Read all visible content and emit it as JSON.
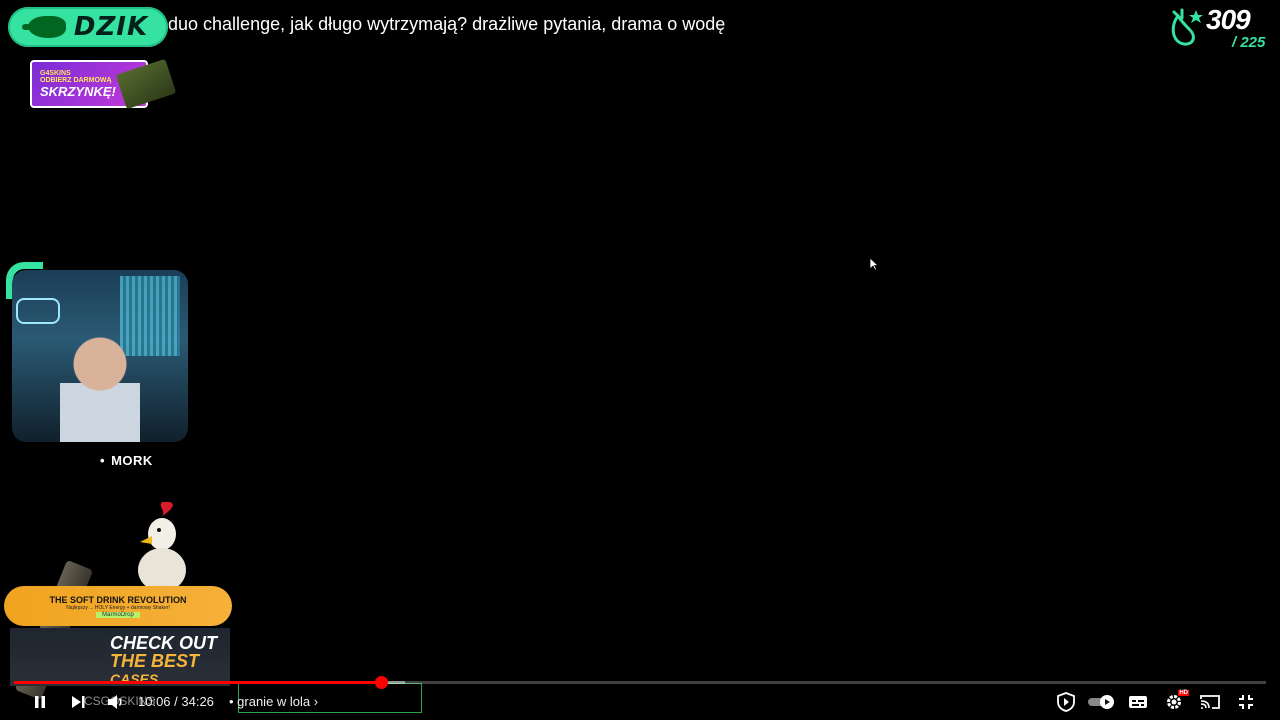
{
  "brand": {
    "name": "DZIK",
    "color": "#35e2a0"
  },
  "video": {
    "title": "duo challenge, jak długo wytrzymają? drażliwe pytania, drama o wodę"
  },
  "promo": {
    "small_text": "ODBIERZ DARMOWĄ",
    "big_text": "SKRZYNKĘ!",
    "logo_text": "G4SKINS"
  },
  "counter": {
    "value": "309",
    "total": "/ 225",
    "icon": "eggplant-icon"
  },
  "webcam": {
    "streamer_name": "MORK"
  },
  "sponsor": {
    "headline": "THE SOFT DRINK REVOLUTION",
    "subline": "Najlepszy ... HOLY Energy + darmowy Shaker!",
    "code": "MarmoDrop",
    "cases_line1": "CHECK OUT",
    "cases_line2": "THE BEST",
    "cases_line3": "CASES",
    "overlay_label": "CSGOSKINS"
  },
  "player": {
    "current_time": "10:06",
    "duration": "34:26",
    "time_text": "10:06 / 34:26",
    "chapter_text": "• granie w lola ›",
    "progress_fraction": 0.293,
    "buffered_fraction": 0.312,
    "accent_color": "#ff0000",
    "controls": {
      "play_pause": "pause-icon",
      "next": "next-icon",
      "volume": "volume-icon",
      "sponsorblock": "shield-icon",
      "autoplay": "autoplay-toggle-icon",
      "subtitles": "subtitles-icon",
      "settings": "settings-gear-icon",
      "settings_badge": "HD",
      "cast": "cast-icon",
      "fullscreen_exit": "exit-fullscreen-icon"
    }
  }
}
